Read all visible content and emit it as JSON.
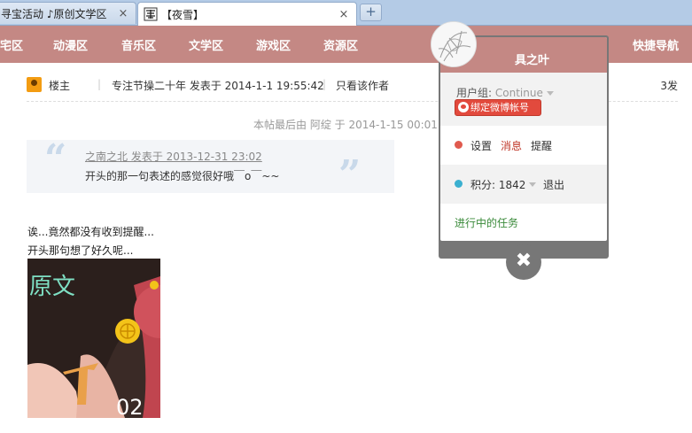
{
  "browser": {
    "tabs": [
      {
        "label": "寻宝活动 ♪原创文学区",
        "active": false
      },
      {
        "label": "【夜雪】",
        "active": true
      }
    ],
    "close_glyph": "×",
    "new_tab_glyph": "+"
  },
  "navbar": {
    "items": [
      "宅区",
      "动漫区",
      "音乐区",
      "文学区",
      "游戏区",
      "资源区"
    ],
    "right": "快捷导航",
    "bg_color": "#c48884"
  },
  "post": {
    "role": "楼主",
    "meta": "专注节操二十年 发表于 2014-1-1 19:55:42",
    "author_only": "只看该作者",
    "floor": "3发",
    "edited_note": "本帖最后由 阿绽 于 2014-1-15 00:01 编辑",
    "quote": {
      "author_line": "之南之北 发表于 2013-12-31 23:02",
      "text": "开头的那一句表述的感觉很好哦￣o￣~~"
    },
    "body": [
      "诶...竟然都没有收到提醒...",
      "开头那句想了好久呢..."
    ],
    "image_text": {
      "top": "原文",
      "bottom": "02"
    }
  },
  "user_popup": {
    "username": "具之叶",
    "group_label": "用户组:",
    "group_value": "Continue",
    "weibo_button": "绑定微博帐号",
    "settings": "设置",
    "messages": "消息",
    "reminders": "提醒",
    "points": "积分: 1842",
    "logout": "退出",
    "tasks": "进行中的任务",
    "close_glyph": "✖",
    "colors": {
      "settings_dot": "#e05a4e",
      "points_dot": "#3bb0d0",
      "messages": "#c0392b",
      "tasks": "#3a8a3a"
    }
  }
}
